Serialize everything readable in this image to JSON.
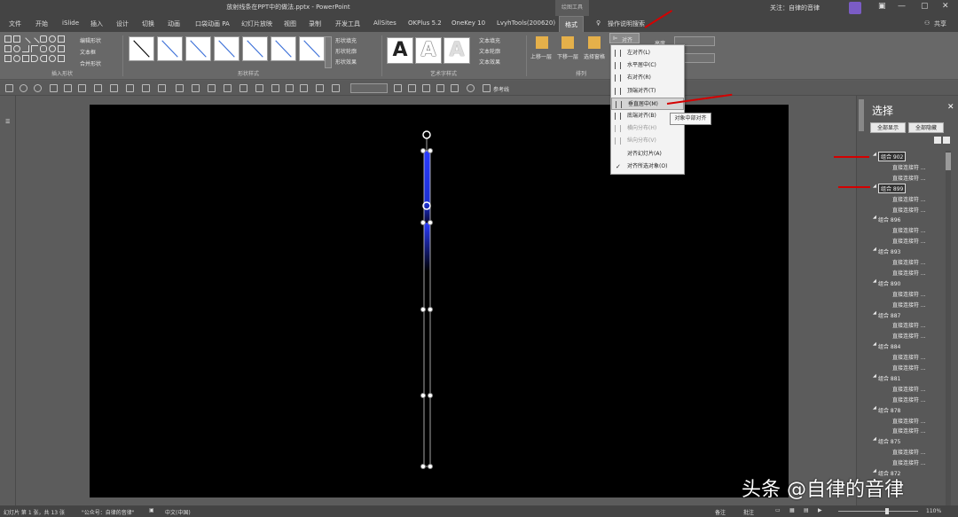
{
  "title_bar": {
    "document_title": "放射线条在PPT中的做法.pptx - PowerPoint",
    "context_tool": "绘图工具",
    "follow_text": "关注：自律的音律",
    "share_label": "共享"
  },
  "tabs": [
    "文件",
    "开始",
    "iSlide",
    "插入",
    "设计",
    "切换",
    "动画",
    "口袋动画 PA",
    "幻灯片放映",
    "视图",
    "录制",
    "开发工具",
    "AllSites",
    "OKPlus 5.2",
    "OneKey 10",
    "LvyhTools(200620)",
    "格式",
    "操作说明搜索"
  ],
  "active_tab": "格式",
  "ribbon": {
    "groups": {
      "insert_shapes": "插入形状",
      "shape_styles": "形状样式",
      "wordart_styles": "艺术字样式",
      "arrange": "排列"
    },
    "insert_shapes_cmds": [
      "编辑形状",
      "文本框",
      "合并形状"
    ],
    "shape_cmds": [
      "形状填充",
      "形状轮廓",
      "形状效果"
    ],
    "text_cmds": [
      "文本填充",
      "文本轮廓",
      "文本效果"
    ],
    "wordart_letter": "A",
    "arrange_cmds": [
      "上移一层",
      "下移一层",
      "选择窗格"
    ],
    "align_button": "对齐",
    "height_label": "高度",
    "width_label": "宽度"
  },
  "align_menu": {
    "items": [
      {
        "label": "左对齐(L)",
        "disabled": false,
        "highlight": false,
        "checked": false
      },
      {
        "label": "水平居中(C)",
        "disabled": false,
        "highlight": false,
        "checked": false
      },
      {
        "label": "右对齐(R)",
        "disabled": false,
        "highlight": false,
        "checked": false
      },
      {
        "label": "顶端对齐(T)",
        "disabled": false,
        "highlight": false,
        "checked": false
      },
      {
        "label": "垂直居中(M)",
        "disabled": false,
        "highlight": true,
        "checked": false
      },
      {
        "label": "底端对齐(B)",
        "disabled": false,
        "highlight": false,
        "checked": false
      },
      {
        "label": "横向分布(H)",
        "disabled": true,
        "highlight": false,
        "checked": false
      },
      {
        "label": "纵向分布(V)",
        "disabled": true,
        "highlight": false,
        "checked": false
      },
      {
        "label": "对齐幻灯片(A)",
        "disabled": false,
        "highlight": false,
        "checked": false
      },
      {
        "label": "对齐所选对象(O)",
        "disabled": false,
        "highlight": false,
        "checked": true
      }
    ],
    "tooltip": "对象中部对齐"
  },
  "selection_pane": {
    "title": "选择",
    "show_all": "全部显示",
    "hide_all": "全部隐藏",
    "rows": [
      {
        "label": "组合 902",
        "level": 0,
        "boxed": true
      },
      {
        "label": "直接连接符 ...",
        "level": 1
      },
      {
        "label": "直接连接符 ...",
        "level": 1
      },
      {
        "label": "组合 899",
        "level": 0,
        "boxed": true
      },
      {
        "label": "直接连接符 ...",
        "level": 1
      },
      {
        "label": "直接连接符 ...",
        "level": 1
      },
      {
        "label": "组合 896",
        "level": 0
      },
      {
        "label": "直接连接符 ...",
        "level": 1
      },
      {
        "label": "直接连接符 ...",
        "level": 1
      },
      {
        "label": "组合 893",
        "level": 0
      },
      {
        "label": "直接连接符 ...",
        "level": 1
      },
      {
        "label": "直接连接符 ...",
        "level": 1
      },
      {
        "label": "组合 890",
        "level": 0
      },
      {
        "label": "直接连接符 ...",
        "level": 1
      },
      {
        "label": "直接连接符 ...",
        "level": 1
      },
      {
        "label": "组合 887",
        "level": 0
      },
      {
        "label": "直接连接符 ...",
        "level": 1
      },
      {
        "label": "直接连接符 ...",
        "level": 1
      },
      {
        "label": "组合 884",
        "level": 0
      },
      {
        "label": "直接连接符 ...",
        "level": 1
      },
      {
        "label": "直接连接符 ...",
        "level": 1
      },
      {
        "label": "组合 881",
        "level": 0
      },
      {
        "label": "直接连接符 ...",
        "level": 1
      },
      {
        "label": "直接连接符 ...",
        "level": 1
      },
      {
        "label": "组合 878",
        "level": 0
      },
      {
        "label": "直接连接符 ...",
        "level": 1
      },
      {
        "label": "直接连接符 ...",
        "level": 1
      },
      {
        "label": "组合 875",
        "level": 0
      },
      {
        "label": "直接连接符 ...",
        "level": 1
      },
      {
        "label": "直接连接符 ...",
        "level": 1
      },
      {
        "label": "组合 872",
        "level": 0
      }
    ]
  },
  "qat": {
    "reference_line_label": "参考线"
  },
  "status_bar": {
    "slide_info": "幻灯片 第 1 张，共 13 张",
    "account": "\"公众号：自律的音律\"",
    "language": "中文(中国)",
    "notes": "备注",
    "comments": "批注",
    "zoom": "110%"
  },
  "watermark": "头条 @自律的音律",
  "colors": {
    "accent_blue": "#1a2ad8",
    "arrow_red": "#d40000",
    "avatar_purple": "#7b5cc5"
  }
}
